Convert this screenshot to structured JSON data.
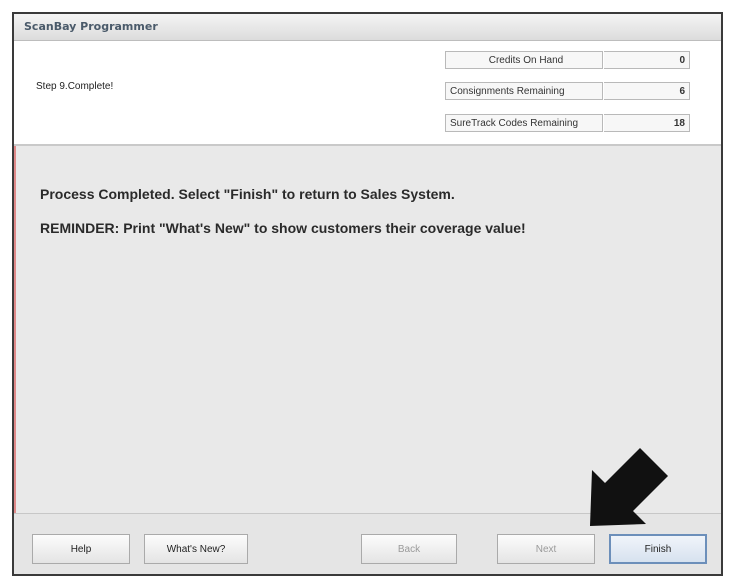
{
  "window": {
    "title": "ScanBay Programmer"
  },
  "header": {
    "step": "Step 9.Complete!",
    "counters": [
      {
        "label": "Credits On Hand",
        "value": "0"
      },
      {
        "label": "Consignments Remaining",
        "value": "6"
      },
      {
        "label": "SureTrack Codes Remaining",
        "value": "18"
      }
    ]
  },
  "content": {
    "line1": "Process Completed. Select \"Finish\" to return to Sales System.",
    "line2": "REMINDER: Print \"What's New\" to show customers their coverage value!"
  },
  "footer": {
    "help": "Help",
    "whats_new": "What's New?",
    "back": "Back",
    "next": "Next",
    "finish": "Finish"
  },
  "colors": {
    "accent_border": "#6c8fba",
    "left_stripe": "#e08a8a"
  },
  "icons": {
    "pointer_arrow": "black-down-left-arrow"
  }
}
